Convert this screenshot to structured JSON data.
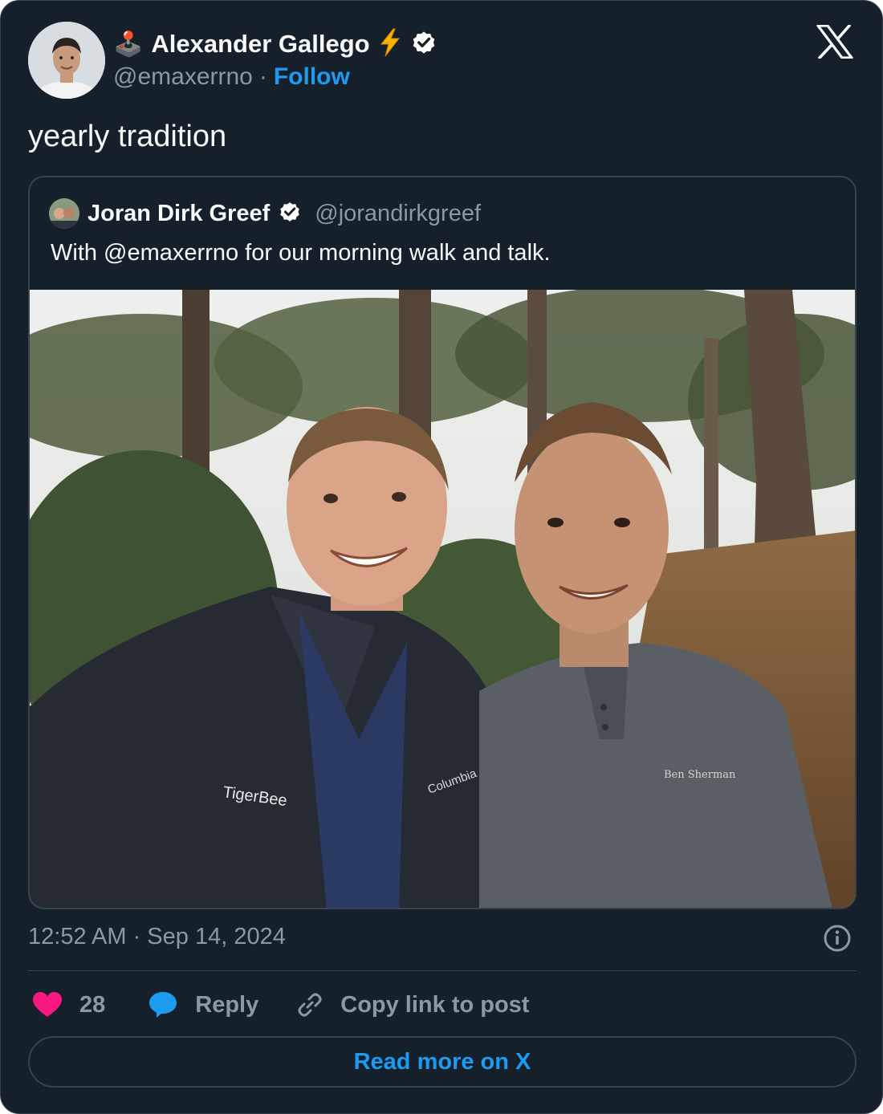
{
  "author": {
    "emoji": "🕹️",
    "name": "Alexander Gallego",
    "bolt": "⚡",
    "handle": "@emaxerrno",
    "separator": "·",
    "follow_label": "Follow"
  },
  "tweet": {
    "text": "yearly tradition"
  },
  "quoted": {
    "name": "Joran Dirk Greef",
    "handle": "@jorandirkgreef",
    "text": "With @emaxerrno for our morning walk and talk."
  },
  "meta": {
    "timestamp": "12:52 AM · Sep 14, 2024"
  },
  "actions": {
    "like_count": "28",
    "reply_label": "Reply",
    "copy_label": "Copy link to post"
  },
  "read_more_label": "Read more on X",
  "colors": {
    "background": "#15202b",
    "border": "#38444d",
    "accent": "#1d9bf0",
    "muted": "#8b98a5",
    "like": "#f91880",
    "lightning": "#f4b400"
  },
  "icons": {
    "verified": "verified-badge-icon",
    "x_logo": "x-logo-icon",
    "info": "info-icon",
    "like": "heart-icon",
    "reply": "speech-bubble-icon",
    "copy": "link-icon"
  }
}
